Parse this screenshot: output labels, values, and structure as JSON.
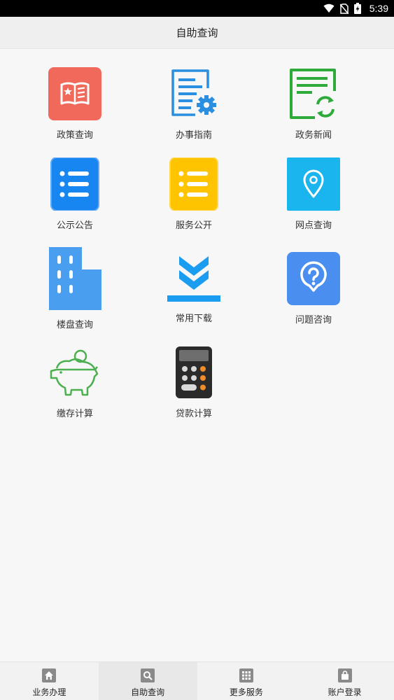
{
  "status_bar": {
    "time": "5:39"
  },
  "header": {
    "title": "自助查询"
  },
  "grid": [
    {
      "label": "政策查询",
      "icon": "policy-book-icon",
      "color": "#f0695a"
    },
    {
      "label": "办事指南",
      "icon": "guide-document-gear-icon",
      "color": "#2a8fe0"
    },
    {
      "label": "政务新闻",
      "icon": "news-document-refresh-icon",
      "color": "#2eaa3a"
    },
    {
      "label": "公示公告",
      "icon": "notice-list-icon",
      "color": "#1886f0"
    },
    {
      "label": "服务公开",
      "icon": "service-list-icon",
      "color": "#ffc400"
    },
    {
      "label": "网点查询",
      "icon": "location-pin-icon",
      "color": "#1ab4ef"
    },
    {
      "label": "楼盘查询",
      "icon": "building-icon",
      "color": "#4a9ef0"
    },
    {
      "label": "常用下载",
      "icon": "download-icon",
      "color": "#1a9cf0"
    },
    {
      "label": "问题咨询",
      "icon": "question-bubble-icon",
      "color": "#4a8ef0"
    },
    {
      "label": "缴存计算",
      "icon": "piggy-bank-icon",
      "color": "#4caf50"
    },
    {
      "label": "贷款计算",
      "icon": "calculator-icon",
      "color": "#2b2b2b"
    }
  ],
  "tabs": [
    {
      "label": "业务办理",
      "icon": "home-icon",
      "active": false
    },
    {
      "label": "自助查询",
      "icon": "search-icon",
      "active": true
    },
    {
      "label": "更多服务",
      "icon": "apps-grid-icon",
      "active": false
    },
    {
      "label": "账户登录",
      "icon": "bag-icon",
      "active": false
    }
  ]
}
